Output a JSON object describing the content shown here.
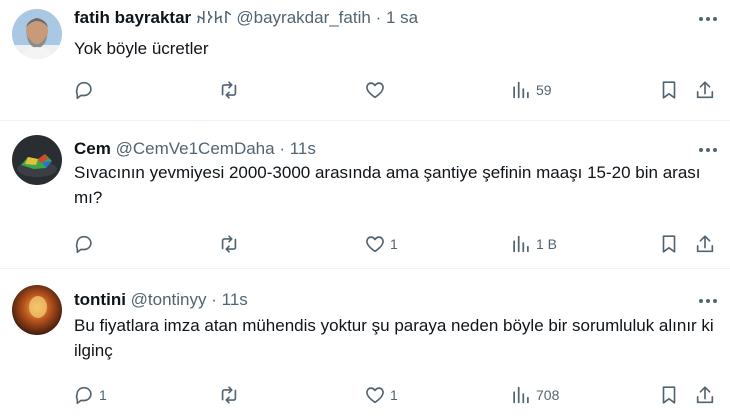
{
  "tweets": [
    {
      "name": "fatih bayraktar",
      "badge": "𐰃𐱅𐰆𐰴",
      "handle": "@bayrakdar_fatih",
      "separator": "·",
      "time": "1 sa",
      "text": "Yok böyle ücretler",
      "reply_count": "",
      "retweet_count": "",
      "like_count": "",
      "view_count": "59"
    },
    {
      "name": "Cem",
      "handle": "@CemVe1CemDaha",
      "separator": "·",
      "time": "11s",
      "text": "Sıvacının yevmiyesi 2000-3000 arasında ama şantiye şefinin maaşı 15-20 bin arası mı?",
      "reply_count": "",
      "retweet_count": "",
      "like_count": "1",
      "view_count": "1 B"
    },
    {
      "name": "tontini",
      "handle": "@tontinyy",
      "separator": "·",
      "time": "11s",
      "text": "Bu fiyatlara imza atan mühendis yoktur şu paraya neden böyle bir sorumluluk alınır ki ilginç",
      "reply_count": "1",
      "retweet_count": "",
      "like_count": "1",
      "view_count": "708"
    }
  ],
  "icons": {
    "reply": "reply-bubble-icon",
    "retweet": "retweet-icon",
    "like": "heart-icon",
    "views": "analytics-bars-icon",
    "bookmark": "bookmark-icon",
    "share": "share-upload-icon",
    "more": "more-dots-icon"
  },
  "colors": {
    "text": "#0f1419",
    "muted": "#536471",
    "divider": "#eff3f4"
  }
}
